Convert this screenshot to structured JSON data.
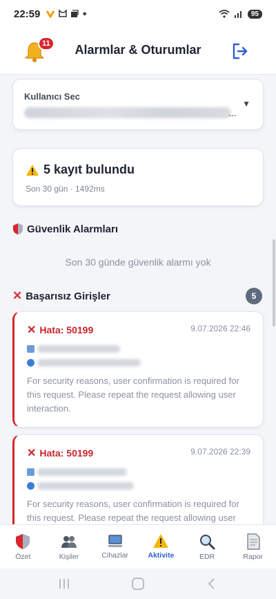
{
  "status": {
    "time": "22:59",
    "battery": "95"
  },
  "header": {
    "title": "Alarmlar & Oturumlar",
    "notification_count": "11"
  },
  "user_select": {
    "label": "Kullanıcı Sec",
    "value_suffix": "..."
  },
  "summary": {
    "title": "5 kayıt bulundu",
    "subtitle": "Son 30 gün · 1492ms"
  },
  "security_alarms": {
    "title": "Güvenlik Alarmları",
    "empty_text": "Son 30 günde güvenlik alarmı yok"
  },
  "failed_logins": {
    "title": "Başarısız Girişler",
    "count": "5",
    "items": [
      {
        "error": "Hata: 50199",
        "date": "9.07.2026 22:46",
        "message": "For security reasons, user confirmation is required for this request. Please repeat the request allowing user interaction."
      },
      {
        "error": "Hata: 50199",
        "date": "9.07.2026 22:39",
        "message": "For security reasons, user confirmation is required for this request. Please repeat the request allowing user interaction."
      }
    ]
  },
  "nav": {
    "items": [
      {
        "label": "Özet",
        "icon": "shield-icon"
      },
      {
        "label": "Kişiler",
        "icon": "users-icon"
      },
      {
        "label": "Cihazlar",
        "icon": "laptop-icon"
      },
      {
        "label": "Aktivite",
        "icon": "warning-icon",
        "active": true
      },
      {
        "label": "EDR",
        "icon": "magnifier-icon"
      },
      {
        "label": "Rapor",
        "icon": "document-icon"
      }
    ]
  },
  "colors": {
    "accent": "#2f5fd0",
    "danger": "#d8262f",
    "muted": "#8a91a0"
  }
}
